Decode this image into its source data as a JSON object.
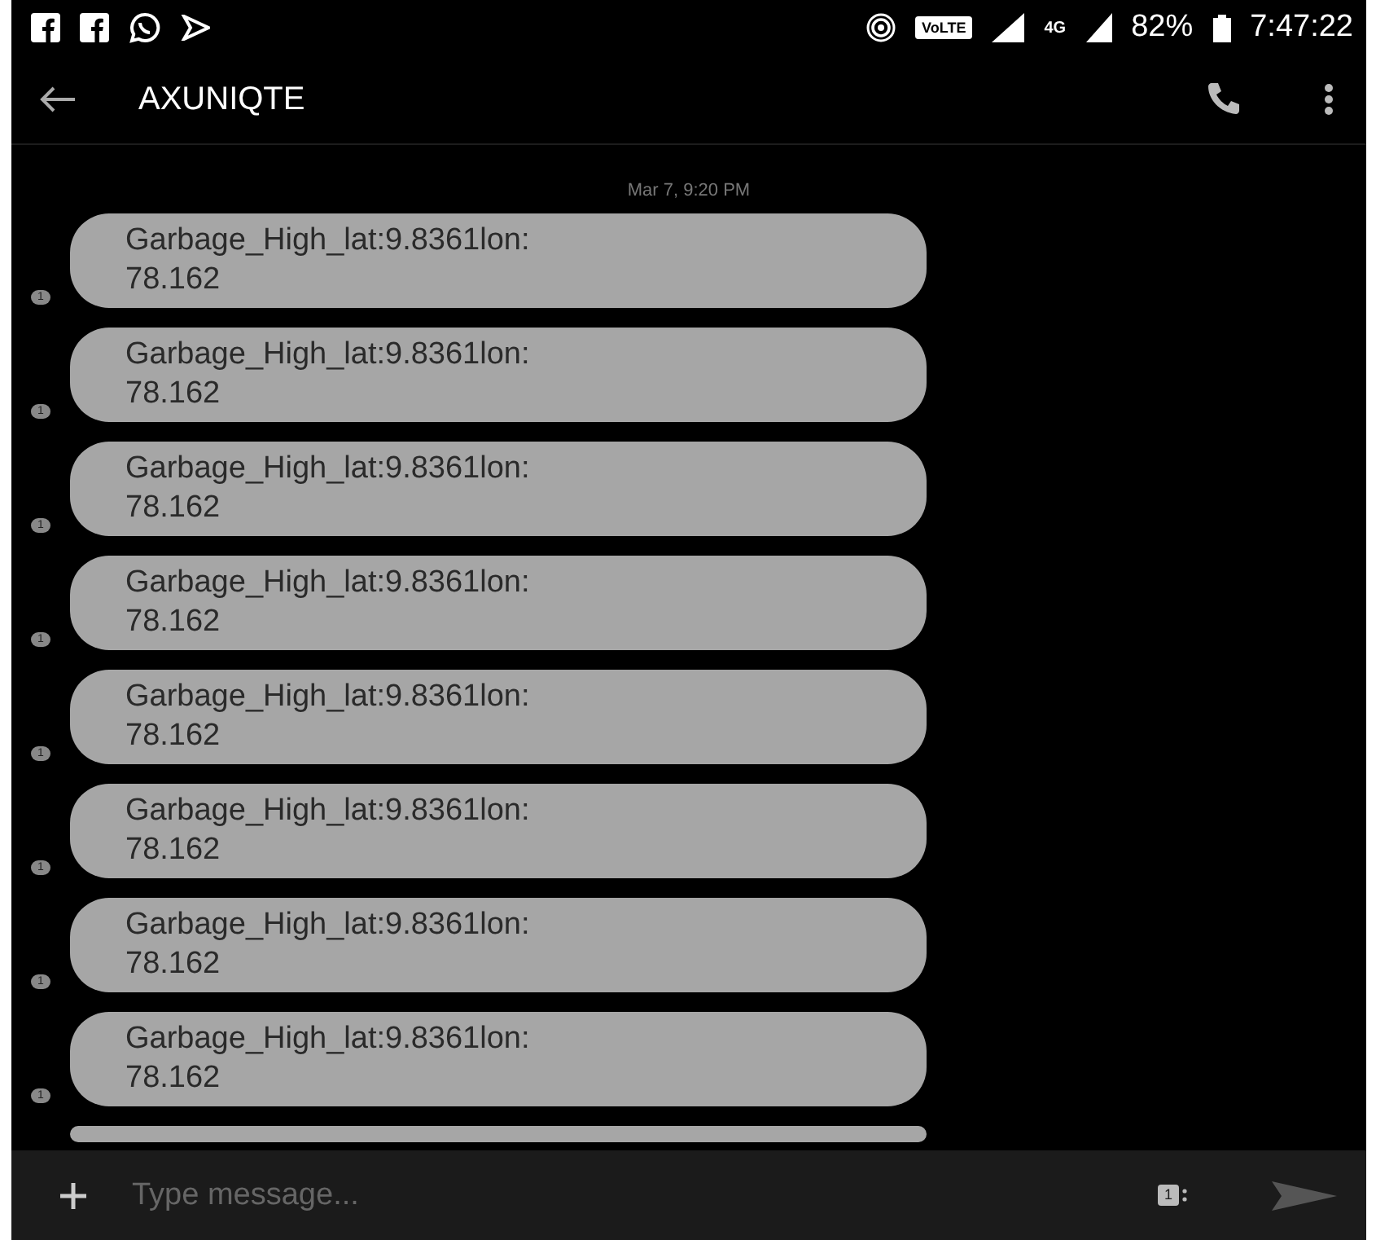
{
  "status_bar": {
    "volte": "VoLTE",
    "network": "4G",
    "battery": "82%",
    "time": "7:47:22"
  },
  "header": {
    "title": "AXUNIQTE"
  },
  "date": "Mar 7, 9:20 PM",
  "messages": [
    {
      "kind": "full",
      "text": "Garbage_High_lat:9.8361lon:\n78.162",
      "sim": "1"
    },
    {
      "kind": "full",
      "text": "Garbage_High_lat:9.8361lon:\n78.162",
      "sim": "1"
    },
    {
      "kind": "full",
      "text": "Garbage_High_lat:9.8361lon:\n78.162",
      "sim": "1"
    },
    {
      "kind": "full",
      "text": "Garbage_High_lat:9.8361lon:\n78.162",
      "sim": "1"
    },
    {
      "kind": "full",
      "text": "Garbage_High_lat:9.8361lon:\n78.162",
      "sim": "1"
    },
    {
      "kind": "full",
      "text": "Garbage_High_lat:9.8361lon:\n78.162",
      "sim": "1"
    },
    {
      "kind": "full",
      "text": "Garbage_High_lat:9.8361lon:\n78.162",
      "sim": "1"
    },
    {
      "kind": "full",
      "text": "Garbage_High_lat:9.8361lon:\n78.162",
      "sim": "1"
    },
    {
      "kind": "cut"
    }
  ],
  "composer": {
    "placeholder": "Type message...",
    "sim": "1"
  }
}
